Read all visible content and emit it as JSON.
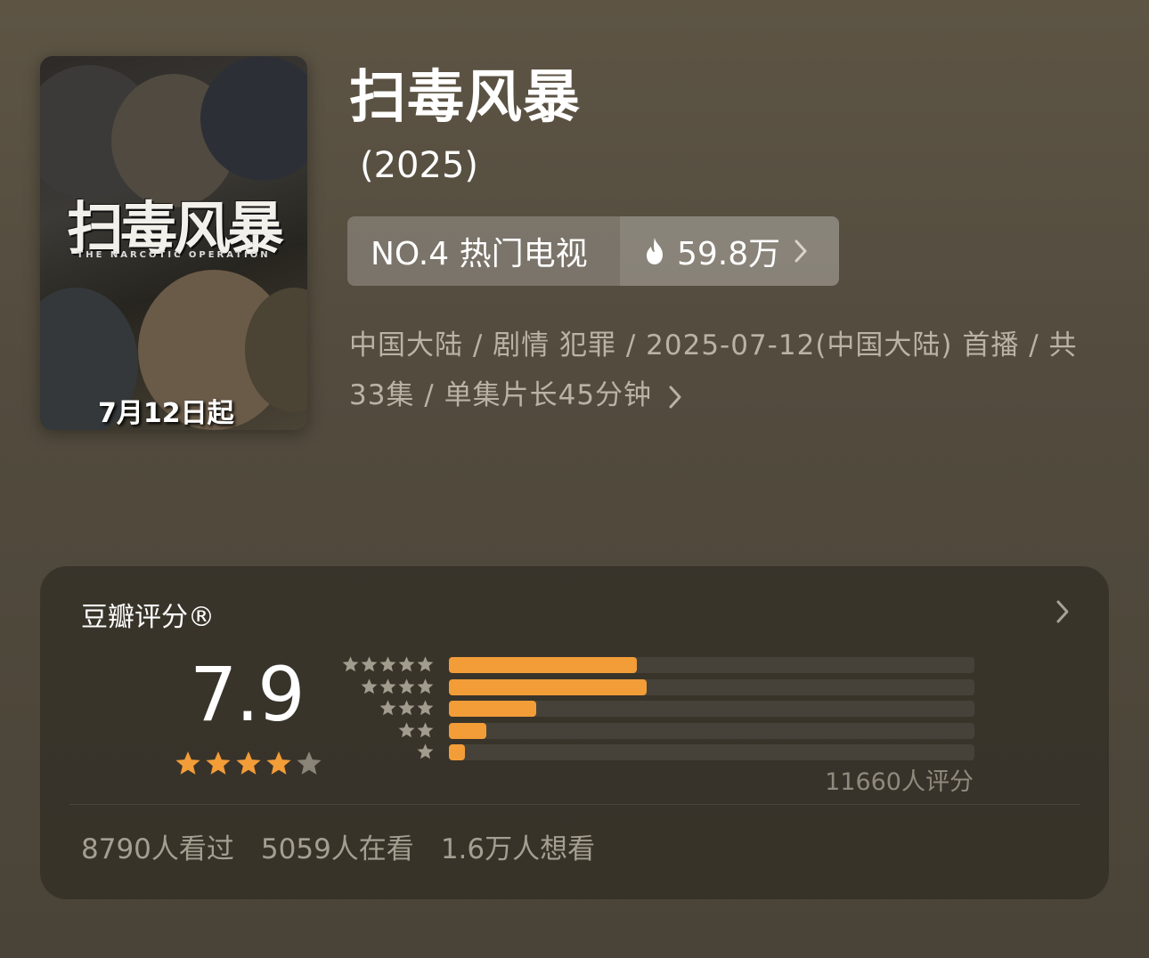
{
  "poster": {
    "title_text": "扫毒风暴",
    "subtitle_text": "THE NARCOTIC OPERATION",
    "date_text": "7月12日起"
  },
  "header": {
    "title": "扫毒风暴",
    "year": "(2025)"
  },
  "rank": {
    "label": "NO.4 热门电视",
    "heat": "59.8万",
    "icons": [
      "flame-icon",
      "chevron-right-icon"
    ]
  },
  "info": {
    "text": "中国大陆 / 剧情 犯罪 / 2025-07-12(中国大陆) 首播 / 共 33集 / 单集片长45分钟"
  },
  "rating": {
    "title": "豆瓣评分®",
    "score": "7.9",
    "stars_filled": 4,
    "stars_total": 5,
    "distribution": [
      {
        "stars": 5,
        "fraction": 0.357
      },
      {
        "stars": 4,
        "fraction": 0.377
      },
      {
        "stars": 3,
        "fraction": 0.166
      },
      {
        "stars": 2,
        "fraction": 0.071
      },
      {
        "stars": 1,
        "fraction": 0.031
      }
    ],
    "raters": "11660人评分"
  },
  "stats": {
    "watched": "8790人看过",
    "watching": "5059人在看",
    "want": "1.6万人想看"
  },
  "colors": {
    "accent": "#f29d38",
    "background": "#554d3f",
    "card": "#3a352d"
  }
}
